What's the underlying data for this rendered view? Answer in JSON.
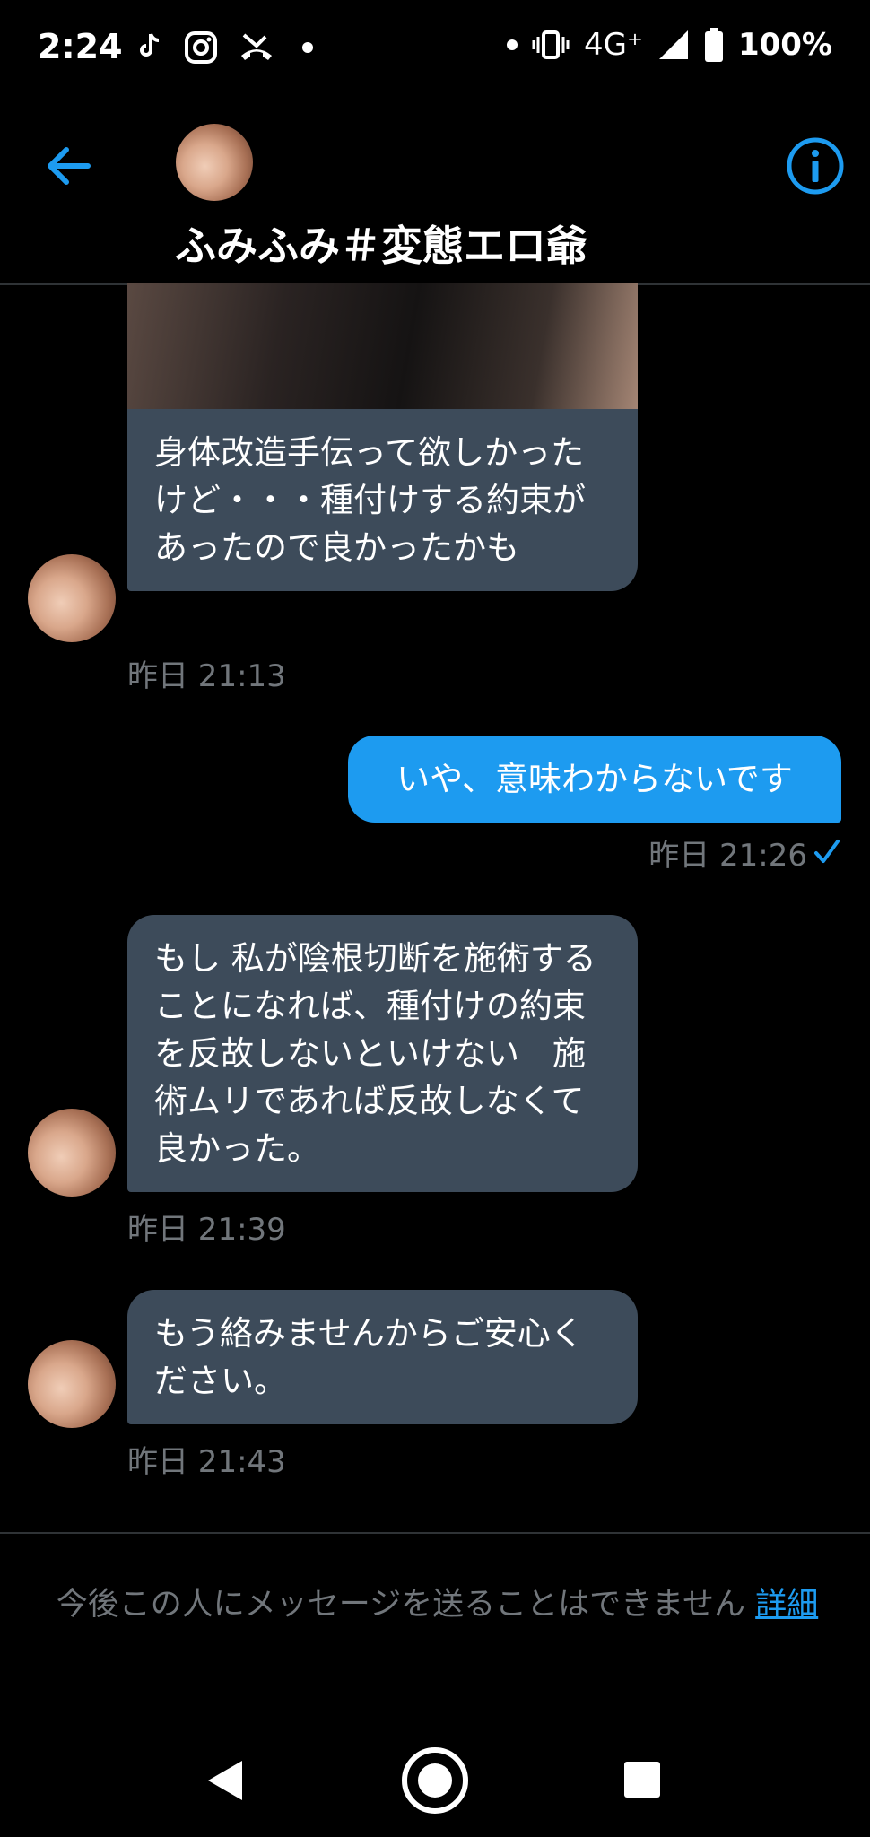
{
  "status_bar": {
    "time": "2:24",
    "network": "4G⁺",
    "battery": "100%",
    "left_icons": [
      "tiktok-icon",
      "instagram-icon",
      "missed-call-icon",
      "dot-icon"
    ],
    "right_icons": [
      "dot-icon",
      "vibrate-icon",
      "signal-icon",
      "battery-icon"
    ]
  },
  "header": {
    "title": "ふみふみ＃変態エロ爺",
    "back_icon": "arrow-left-icon",
    "info_icon": "info-circle-icon"
  },
  "messages": [
    {
      "from": "other",
      "text": "身体改造手伝って欲しかったけど・・・種付けする約束があったので良かったかも",
      "time": "昨日 21:13",
      "has_image": true
    },
    {
      "from": "me",
      "text": "いや、意味わからないです",
      "time": "昨日 21:26",
      "read": true
    },
    {
      "from": "other",
      "text": "もし 私が陰根切断を施術することになれば、種付けの約束を反故しないといけない　施術ムリであれば反故しなくて良かった。",
      "time": "昨日 21:39"
    },
    {
      "from": "other",
      "text": "もう絡みませんからご安心ください。",
      "time": "昨日 21:43"
    }
  ],
  "footer": {
    "notice": "今後この人にメッセージを送ることはできません",
    "link": "詳細"
  },
  "nav": {
    "back": "nav-back-icon",
    "home": "nav-home-icon",
    "recents": "nav-recents-icon"
  },
  "colors": {
    "accent": "#1d9bf0",
    "bubble_other": "#3d4b5a",
    "muted": "#71767b",
    "divider": "#2f3336"
  }
}
